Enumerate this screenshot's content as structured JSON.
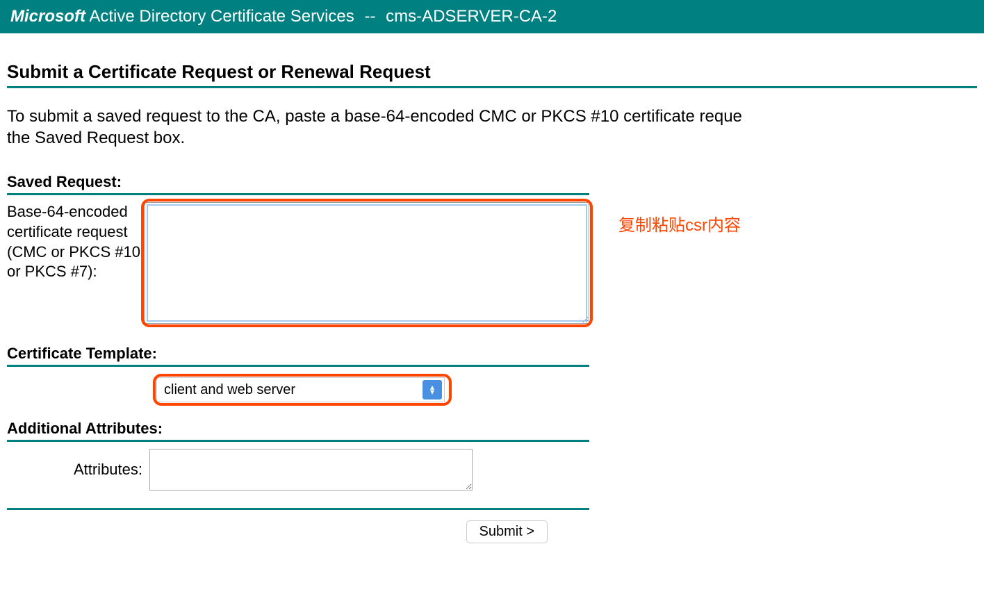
{
  "header": {
    "brand": "Microsoft",
    "service": "Active Directory Certificate Services",
    "separator": "--",
    "ca_name": "cms-ADSERVER-CA-2"
  },
  "page": {
    "title": "Submit a Certificate Request or Renewal Request",
    "instructions": "To submit a saved request to the CA, paste a base-64-encoded CMC or PKCS #10 certificate reque\nthe Saved Request box."
  },
  "saved_request": {
    "section_title": "Saved Request:",
    "label": "Base-64-encoded certificate request (CMC or PKCS #10 or PKCS #7):",
    "value": ""
  },
  "template": {
    "section_title": "Certificate Template:",
    "selected": "client and web server"
  },
  "attributes": {
    "section_title": "Additional Attributes:",
    "label": "Attributes:",
    "value": ""
  },
  "submit": {
    "label": "Submit >"
  },
  "annotation": {
    "csr_note": "复制粘贴csr内容"
  },
  "colors": {
    "teal": "#008080",
    "highlight": "#ff4500"
  }
}
